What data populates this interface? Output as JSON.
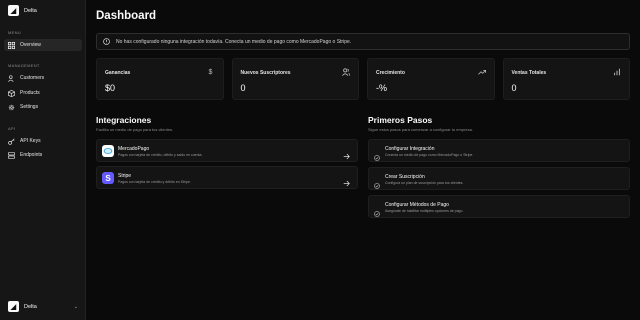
{
  "app": {
    "brand": "Delta"
  },
  "sidebar": {
    "sections": [
      {
        "label": "MENU",
        "items": [
          {
            "label": "Overview",
            "icon": "grid-icon",
            "active": true
          }
        ]
      },
      {
        "label": "MANAGEMENT",
        "items": [
          {
            "label": "Customers",
            "icon": "users-icon"
          },
          {
            "label": "Products",
            "icon": "package-icon"
          },
          {
            "label": "Settings",
            "icon": "gear-icon"
          }
        ]
      },
      {
        "label": "API",
        "items": [
          {
            "label": "API Keys",
            "icon": "key-icon"
          },
          {
            "label": "Endpoints",
            "icon": "server-icon"
          }
        ]
      }
    ],
    "footer": {
      "name": "Delta",
      "chevron": "⌄"
    }
  },
  "main": {
    "title": "Dashboard",
    "alert": "No has configurado ninguna integración todavía. Conecta un medio de pago como MercadoPago o Stripe.",
    "stats": [
      {
        "title": "Ganancias",
        "value": "$0",
        "icon": "dollar-icon"
      },
      {
        "title": "Nuevos Suscriptores",
        "value": "0",
        "icon": "users-icon"
      },
      {
        "title": "Crecimiento",
        "value": "-%",
        "icon": "trending-up-icon"
      },
      {
        "title": "Ventas Totales",
        "value": "0",
        "icon": "bar-chart-icon"
      }
    ],
    "integrations": {
      "title": "Integraciones",
      "subtitle": "Facilita un medio de pago para tus clientes.",
      "items": [
        {
          "title": "MercadoPago",
          "desc": "Pagos con tarjeta de crédito, débito y saldo en cuenta.",
          "color": "#ffffff"
        },
        {
          "title": "Stripe",
          "desc": "Pagos con tarjeta de crédito y débito en Stripe.",
          "color": "#635bff"
        }
      ]
    },
    "steps": {
      "title": "Primeros Pasos",
      "subtitle": "Sigue estos pasos para comenzar a configurar tu empresa.",
      "items": [
        {
          "title": "Configurar Integración",
          "desc": "Conecta un medio de pago como MercadoPago o Stripe."
        },
        {
          "title": "Crear Suscripción",
          "desc": "Configura un plan de suscripción para tus clientes."
        },
        {
          "title": "Configurar Métodos de Pago",
          "desc": "Asegúrate de habilitar múltiples opciones de pago."
        }
      ]
    }
  }
}
